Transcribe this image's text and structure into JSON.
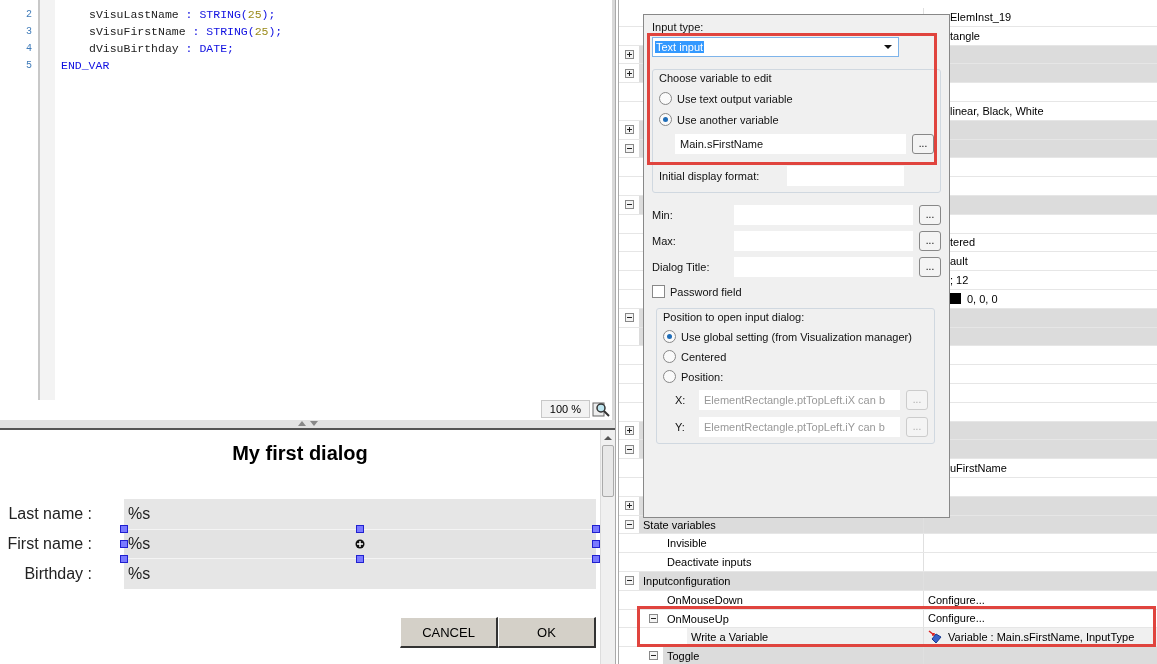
{
  "code_editor": {
    "lines": [
      {
        "number": "2",
        "indented": true,
        "tokens": [
          {
            "kind": "ident",
            "text": "sVisuLastName"
          },
          {
            "kind": "keyword",
            "text": " : STRING("
          },
          {
            "kind": "number",
            "text": "25"
          },
          {
            "kind": "keyword",
            "text": ");"
          }
        ]
      },
      {
        "number": "3",
        "indented": true,
        "tokens": [
          {
            "kind": "ident",
            "text": "sVisuFirstName"
          },
          {
            "kind": "keyword",
            "text": " : STRING("
          },
          {
            "kind": "number",
            "text": "25"
          },
          {
            "kind": "keyword",
            "text": ");"
          }
        ]
      },
      {
        "number": "4",
        "indented": true,
        "tokens": [
          {
            "kind": "ident",
            "text": "dVisuBirthday"
          },
          {
            "kind": "keyword",
            "text": " : DATE;"
          }
        ]
      },
      {
        "number": "5",
        "indented": false,
        "tokens": [
          {
            "kind": "keyword",
            "text": "END_VAR"
          }
        ]
      }
    ],
    "zoom": "100 %"
  },
  "visualization": {
    "title": "My first dialog",
    "fields": [
      {
        "label": "Last name :",
        "value": "%s",
        "selected": false
      },
      {
        "label": "First name :",
        "value": "%s",
        "selected": true
      },
      {
        "label": "Birthday :",
        "value": "%s",
        "selected": false
      }
    ],
    "buttons": [
      "CANCEL",
      "OK"
    ]
  },
  "properties": {
    "rows": [
      {
        "kind": "prop",
        "value": "ElemInst_19"
      },
      {
        "kind": "prop",
        "value": "tangle"
      },
      {
        "kind": "group",
        "expanded": false
      },
      {
        "kind": "group",
        "expanded": false
      },
      {
        "kind": "prop"
      },
      {
        "kind": "prop",
        "value": "linear, Black, White"
      },
      {
        "kind": "group",
        "expanded": false
      },
      {
        "kind": "group",
        "expanded": true
      },
      {
        "kind": "prop"
      },
      {
        "kind": "prop"
      },
      {
        "kind": "group",
        "expanded": true
      },
      {
        "kind": "prop"
      },
      {
        "kind": "prop",
        "value": "tered"
      },
      {
        "kind": "prop",
        "value": "ault"
      },
      {
        "kind": "prop",
        "value": "; 12"
      },
      {
        "kind": "color",
        "value": "0, 0, 0",
        "color": "#000000"
      },
      {
        "kind": "group",
        "expanded": true
      },
      {
        "kind": "group"
      },
      {
        "kind": "prop"
      },
      {
        "kind": "prop"
      },
      {
        "kind": "prop"
      },
      {
        "kind": "prop"
      },
      {
        "kind": "group",
        "expanded": false
      },
      {
        "kind": "group",
        "expanded": true
      },
      {
        "kind": "prop",
        "value": "uFirstName"
      },
      {
        "kind": "prop"
      },
      {
        "kind": "group",
        "expanded": false
      },
      {
        "kind": "group",
        "name": "State variables",
        "expanded": true,
        "children": [
          {
            "kind": "prop",
            "name": "Invisible"
          },
          {
            "kind": "prop",
            "name": "Deactivate inputs"
          }
        ]
      },
      {
        "kind": "group",
        "name": "Inputconfiguration",
        "expanded": true,
        "children": [
          {
            "kind": "prop",
            "name": "OnMouseDown",
            "value": "Configure..."
          },
          {
            "kind": "prop",
            "name": "OnMouseUp",
            "value": "Configure...",
            "expanded": true,
            "children": [
              {
                "kind": "action",
                "name": "Write a Variable",
                "value": "Variable : Main.sFirstName, InputType"
              }
            ]
          },
          {
            "kind": "group",
            "name": "Toggle",
            "expanded": true
          }
        ]
      }
    ]
  },
  "input_dialog": {
    "input_type_label": "Input type:",
    "input_type": "Text input",
    "variable_group": {
      "legend": "Choose variable to edit",
      "options": [
        {
          "label": "Use text output variable",
          "selected": false
        },
        {
          "label": "Use another variable",
          "selected": true
        }
      ],
      "variable": "Main.sFirstName",
      "browse": "..."
    },
    "initial_format_label": "Initial display format:",
    "fields": [
      {
        "label": "Min:",
        "browse": "..."
      },
      {
        "label": "Max:",
        "browse": "..."
      },
      {
        "label": "Dialog Title:",
        "browse": "..."
      }
    ],
    "password": {
      "label": "Password field",
      "checked": false
    },
    "position_group": {
      "legend": "Position to open input dialog:",
      "options": [
        {
          "label": "Use global setting (from Visualization manager)",
          "selected": true
        },
        {
          "label": "Centered",
          "selected": false
        },
        {
          "label": "Position:",
          "selected": false
        }
      ],
      "coords": [
        {
          "label": "X:",
          "value": "ElementRectangle.ptTopLeft.iX can b",
          "browse": "...",
          "disabled": true
        },
        {
          "label": "Y:",
          "value": "ElementRectangle.ptTopLeft.iY can b",
          "browse": "...",
          "disabled": true
        }
      ]
    }
  }
}
